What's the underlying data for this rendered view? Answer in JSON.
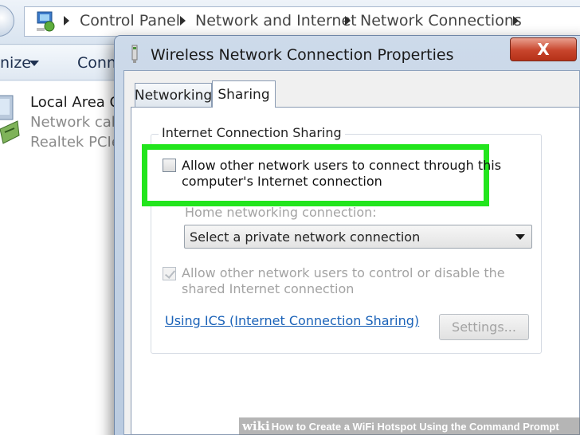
{
  "breadcrumb": {
    "items": [
      "Control Panel",
      "Network and Internet",
      "Network Connections"
    ]
  },
  "toolbar": {
    "organize_label": "nize",
    "connect_label": "Conn"
  },
  "connection": {
    "name": "Local Area Co",
    "status": "Network cabl",
    "adapter": "Realtek PCIe"
  },
  "dialog": {
    "title": "Wireless Network Connection Properties",
    "close_label": "X",
    "tabs": [
      {
        "label": "Networking",
        "active": false
      },
      {
        "label": "Sharing",
        "active": true
      }
    ],
    "group_title": "Internet Connection Sharing",
    "allow_connect": {
      "line1": "Allow other network users to connect through this",
      "line2": "computer's Internet connection",
      "checked": false
    },
    "home_networking_label": "Home networking connection:",
    "home_networking_value": "Select a private network connection",
    "allow_control": {
      "line1": "Allow other network users to control or disable the",
      "line2": "shared Internet connection",
      "checked": true,
      "enabled": false
    },
    "ics_link": "Using ICS (Internet Connection Sharing)",
    "settings_label": "Settings..."
  },
  "highlight_color": "#22e51d",
  "footer": {
    "logo": "wiki",
    "text": "How to Create a WiFi Hotspot Using the Command Prompt"
  }
}
